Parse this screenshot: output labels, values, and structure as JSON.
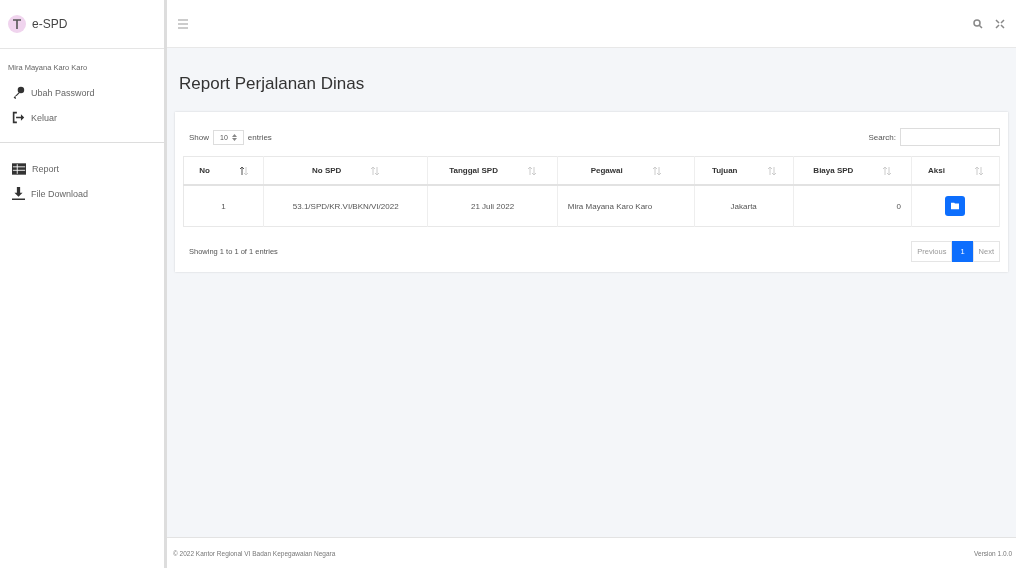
{
  "brand": {
    "name": "e-SPD"
  },
  "sidebar": {
    "user": "Mira Mayana Karo Karo",
    "account_items": [
      {
        "label": "Ubah Password",
        "kind": "key"
      },
      {
        "label": "Keluar",
        "kind": "logout"
      }
    ],
    "menu_items": [
      {
        "label": "Report",
        "kind": "report"
      },
      {
        "label": "File Download",
        "kind": "download"
      }
    ]
  },
  "page": {
    "title": "Report Perjalanan Dinas"
  },
  "table_controls": {
    "show_label": "Show",
    "page_size": "10",
    "entries_label": "entries",
    "search_label": "Search:"
  },
  "table": {
    "columns": [
      {
        "label": "No",
        "sorted": true
      },
      {
        "label": "No SPD",
        "sorted": false
      },
      {
        "label": "Tanggal SPD",
        "sorted": false
      },
      {
        "label": "Pegawai",
        "sorted": false
      },
      {
        "label": "Tujuan",
        "sorted": false
      },
      {
        "label": "Biaya SPD",
        "sorted": false
      },
      {
        "label": "Aksi",
        "sorted": false
      }
    ],
    "rows": [
      {
        "no": "1",
        "no_spd": "53.1/SPD/KR.VI/BKN/VI/2022",
        "tanggal": "21 Juli 2022",
        "pegawai": "Mira Mayana Karo Karo",
        "tujuan": "Jakarta",
        "biaya": "0"
      }
    ]
  },
  "table_info": "Showing 1 to 1 of 1 entries",
  "pagination": [
    {
      "label": "Previous",
      "kind": "prev",
      "selected": false
    },
    {
      "label": "1",
      "kind": "page",
      "selected": true
    },
    {
      "label": "Next",
      "kind": "next",
      "selected": false
    }
  ],
  "footer": {
    "copyright": "© 2022 Kantor Regional VI Badan Kepegawaian Negara",
    "version": "Version 1.0.0"
  }
}
